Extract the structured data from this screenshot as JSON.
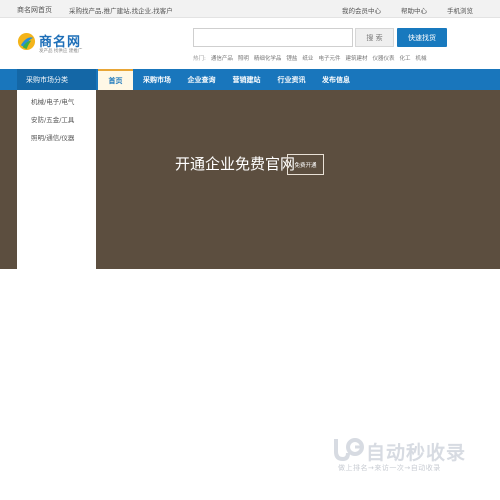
{
  "topbar": {
    "home": "商名网首页",
    "slogan": "采购找产品,推广建站,找企业,找客户",
    "links": [
      "我的会员中心",
      "帮助中心",
      "手机浏览"
    ]
  },
  "logo": {
    "name": "商名网",
    "tagline": "发产品 找供应 建推广"
  },
  "search": {
    "placeholder": "",
    "search_label": "搜 索",
    "quick_label": "快速找货"
  },
  "hot": {
    "label": "热门:",
    "items": [
      "通信产品",
      "照明",
      "精细化学品",
      "锂盐",
      "纸业",
      "电子元件",
      "建筑建材",
      "仪器仪表",
      "化工",
      "机械"
    ]
  },
  "category_header": "采购市场分类",
  "nav": [
    "首页",
    "采购市场",
    "企业查询",
    "营销建站",
    "行业资讯",
    "发布信息"
  ],
  "categories": [
    "机械/电子/电气",
    "安防/五金/工具",
    "照明/通信/仪器"
  ],
  "banner": {
    "headline": "开通企业免费官网",
    "button_label": "免费开通"
  },
  "watermark": {
    "main": "自动秒收录",
    "sub": "做上排名→来访一次→自动收录"
  },
  "colors": {
    "brand_blue": "#1976bc",
    "banner_brown": "#5c4e3f",
    "nav_active_bg": "#fff8e6"
  }
}
